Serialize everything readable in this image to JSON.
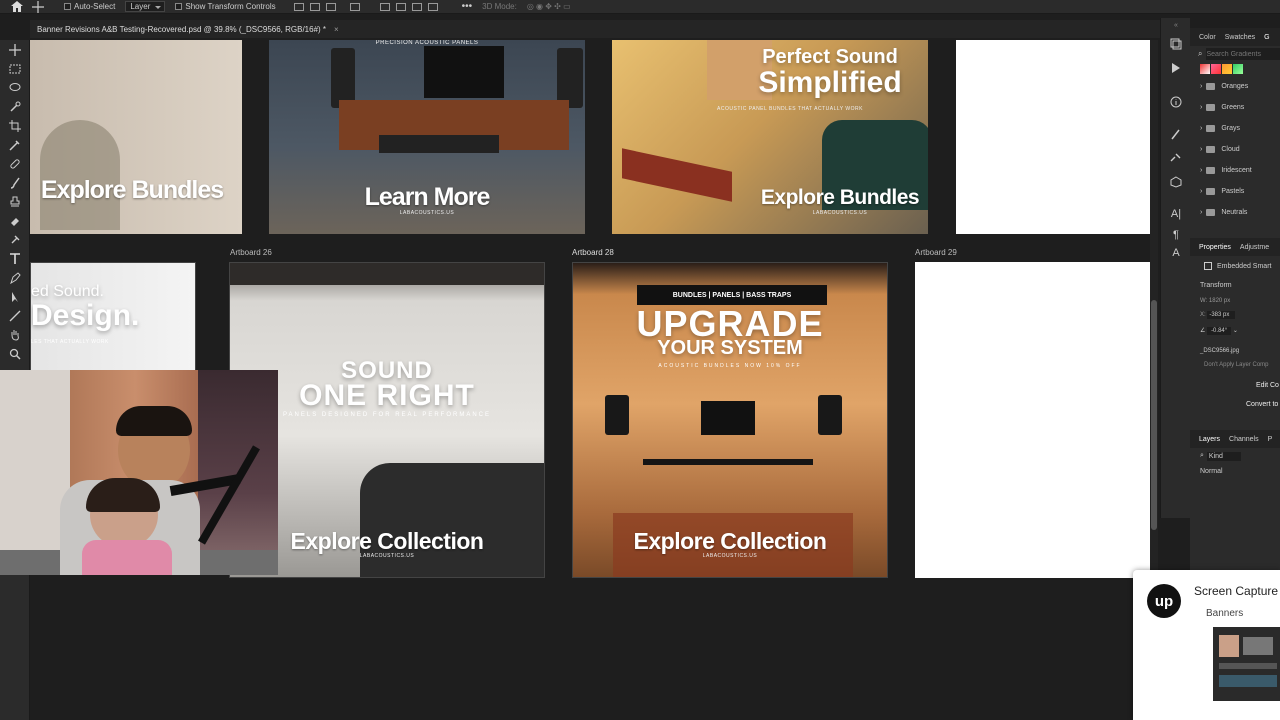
{
  "options_bar": {
    "auto_select": "Auto-Select",
    "layer_select": "Layer",
    "transform_controls": "Show Transform Controls",
    "mode_3d": "3D Mode:"
  },
  "document_tab": {
    "title": "Banner Revisions A&B Testing-Recovered.psd @ 39.8% (_DSC9566, RGB/16#) *",
    "close": "×"
  },
  "artboards": {
    "row1": [
      {
        "headline": "Explore Bundles",
        "tagline": "",
        "url": ""
      },
      {
        "headline": "Learn More",
        "tagline": "PRECISION ACOUSTIC PANELS",
        "url": "LABACOUSTICS.US"
      },
      {
        "headline": "Explore Bundles",
        "title1": "Perfect Sound",
        "title2": "Simplified",
        "tagline": "ACOUSTIC PANEL BUNDLES THAT ACTUALLY WORK",
        "url": "LABACOUSTICS.US"
      }
    ],
    "row2": [
      {
        "label": "",
        "title1": "ed Sound.",
        "title2": "Design.",
        "tagline": "LES THAT ACTUALLY WORK"
      },
      {
        "label": "Artboard 26",
        "title1": "SOUND",
        "title2": "ONE RIGHT",
        "tagline": "PANELS DESIGNED FOR REAL PERFORMANCE",
        "headline": "Explore Collection",
        "url": "LABACOUSTICS.US"
      },
      {
        "label": "Artboard 28",
        "pill": "BUNDLES | PANELS | BASS TRAPS",
        "title1": "UPGRADE",
        "title2": "YOUR SYSTEM",
        "tagline": "ACOUSTIC BUNDLES NOW 10% OFF",
        "headline": "Explore Collection",
        "url": "LABACOUSTICS.US"
      },
      {
        "label": "Artboard 29"
      }
    ]
  },
  "right_panel": {
    "tabs": [
      "Color",
      "Swatches",
      "G"
    ],
    "search_placeholder": "Search Gradients",
    "folders": [
      "Oranges",
      "Greens",
      "Grays",
      "Cloud",
      "Iridescent",
      "Pastels",
      "Neutrals"
    ],
    "props_tabs": [
      "Properties",
      "Adjustme"
    ],
    "embedded": "Embedded Smart",
    "transform": "Transform",
    "w_label": "W:",
    "w_value": "1820 px",
    "x_label": "X:",
    "x_value": "-383 px",
    "angle": "-0.84°",
    "filename": "_DSC9566.jpg",
    "dont_apply": "Don't Apply Layer Comp",
    "edit_btn": "Edit Co",
    "convert_btn": "Convert to",
    "layers_tabs": [
      "Layers",
      "Channels",
      "P"
    ],
    "kind": "Kind",
    "blend": "Normal"
  },
  "popup": {
    "logo": "up",
    "title": "Screen Capture",
    "subtitle": "Banners"
  },
  "colors": {
    "accent": "#ffffff",
    "bg": "#1e1e1e"
  }
}
